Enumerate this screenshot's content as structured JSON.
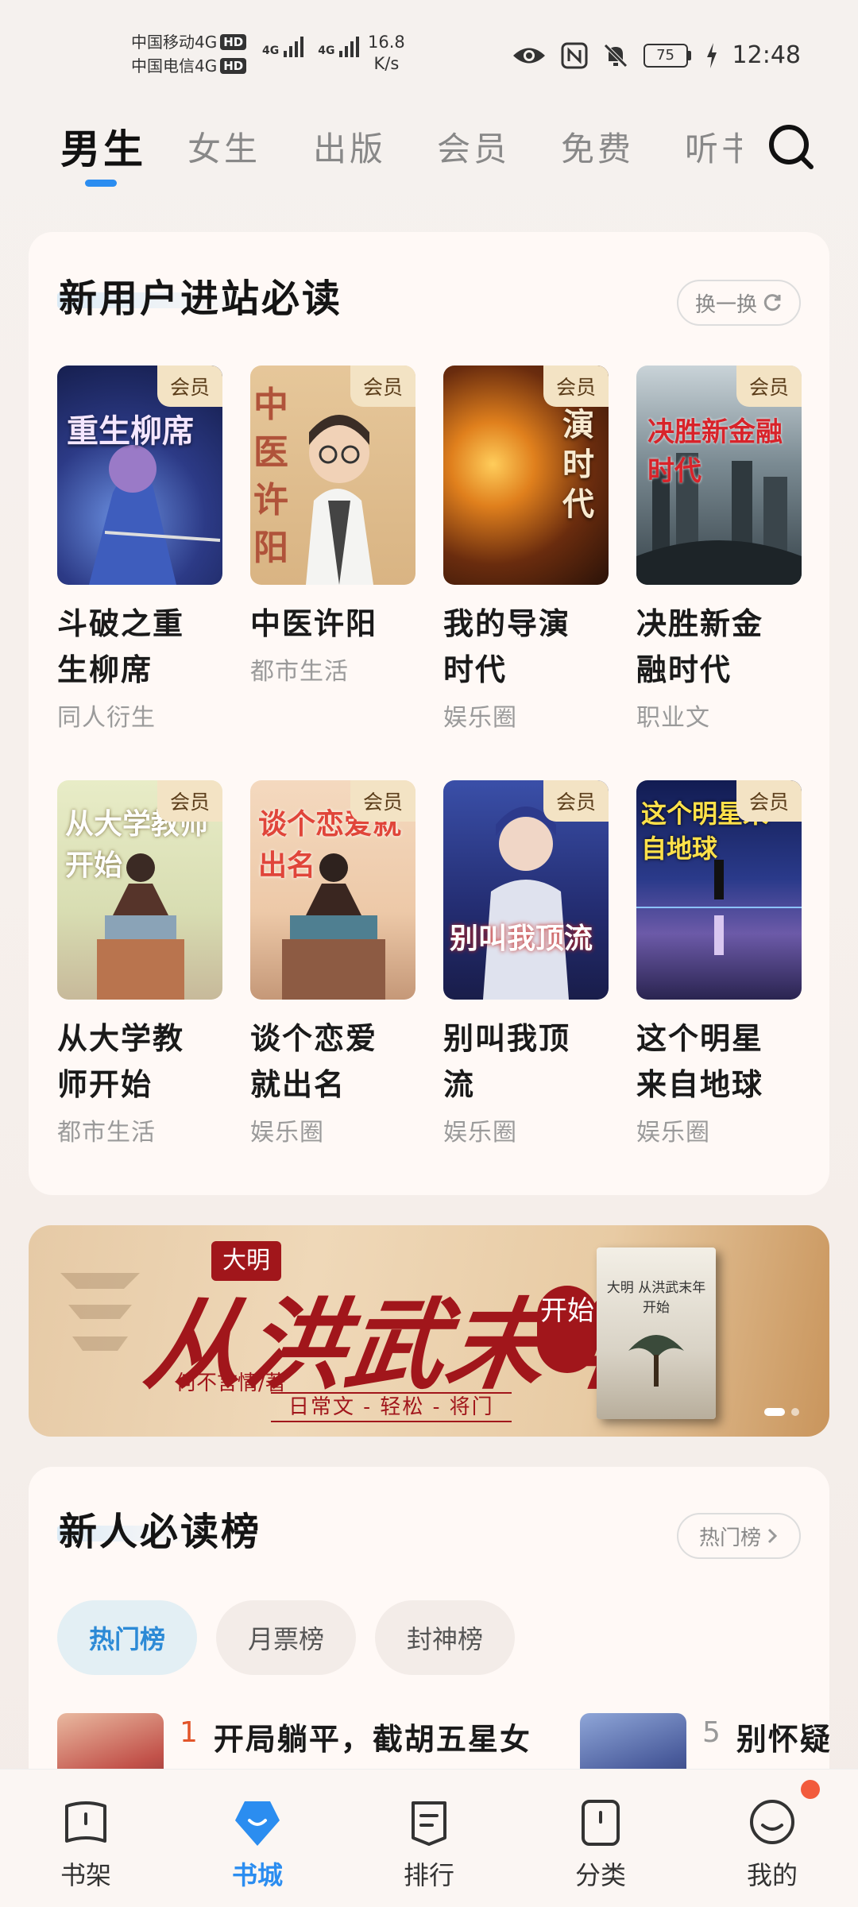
{
  "status_bar": {
    "carrier1": "中国移动4G",
    "carrier2": "中国电信4G",
    "hd": "HD",
    "signal_tag": "4G",
    "speed_value": "16.8",
    "speed_unit": "K/s",
    "battery": "75",
    "time": "12:48"
  },
  "top_tabs": {
    "tabs": [
      {
        "label": "男生",
        "active": true
      },
      {
        "label": "女生"
      },
      {
        "label": "出版"
      },
      {
        "label": "会员"
      },
      {
        "label": "免费"
      },
      {
        "label": "听书"
      }
    ]
  },
  "new_user_section": {
    "title": "新用户进站必读",
    "refresh_label": "换一换",
    "vip_label": "会员",
    "books": [
      {
        "name_l1": "斗破之重",
        "name_l2": "生柳席",
        "genre": "同人衍生",
        "cover_text": "重生柳席"
      },
      {
        "name_l1": "中医许阳",
        "name_l2": "",
        "genre": "都市生活",
        "cover_text": "中医许阳"
      },
      {
        "name_l1": "我的导演",
        "name_l2": "时代",
        "genre": "娱乐圈",
        "cover_text": "演时代"
      },
      {
        "name_l1": "决胜新金",
        "name_l2": "融时代",
        "genre": "职业文",
        "cover_text": "决胜新金融时代"
      },
      {
        "name_l1": "从大学教",
        "name_l2": "师开始",
        "genre": "都市生活",
        "cover_text": "从大学教师开始"
      },
      {
        "name_l1": "谈个恋爱",
        "name_l2": "就出名",
        "genre": "娱乐圈",
        "cover_text": "谈个恋爱就出名"
      },
      {
        "name_l1": "别叫我顶",
        "name_l2": "流",
        "genre": "娱乐圈",
        "cover_text": "别叫我顶流"
      },
      {
        "name_l1": "这个明星",
        "name_l2": "来自地球",
        "genre": "娱乐圈",
        "cover_text": "这个明星来自地球"
      }
    ]
  },
  "banner": {
    "pre_title": "大明",
    "main_title": "从洪武末年",
    "seal": "开始",
    "author": "何不言情/著",
    "tags": "日常文 - 轻松 - 将门",
    "book_title": "大明 从洪武末年开始"
  },
  "rank_section": {
    "title": "新人必读榜",
    "more_label": "热门榜",
    "chips": [
      {
        "label": "热门榜",
        "active": true
      },
      {
        "label": "月票榜"
      },
      {
        "label": "封神榜"
      }
    ],
    "rows": [
      {
        "num": "1",
        "title": "开局躺平，截胡五星女"
      },
      {
        "num": "5",
        "title": "别怀疑"
      }
    ]
  },
  "bottom_nav": {
    "items": [
      {
        "label": "书架",
        "icon": "bookshelf-icon"
      },
      {
        "label": "书城",
        "icon": "bookstore-icon",
        "active": true
      },
      {
        "label": "排行",
        "icon": "ranking-icon"
      },
      {
        "label": "分类",
        "icon": "category-icon"
      },
      {
        "label": "我的",
        "icon": "profile-icon"
      }
    ]
  },
  "colors": {
    "accent": "#2b8df0",
    "rank_red": "#e2552a",
    "banner_red": "#a1161b",
    "notify_dot": "#f25b3c"
  }
}
